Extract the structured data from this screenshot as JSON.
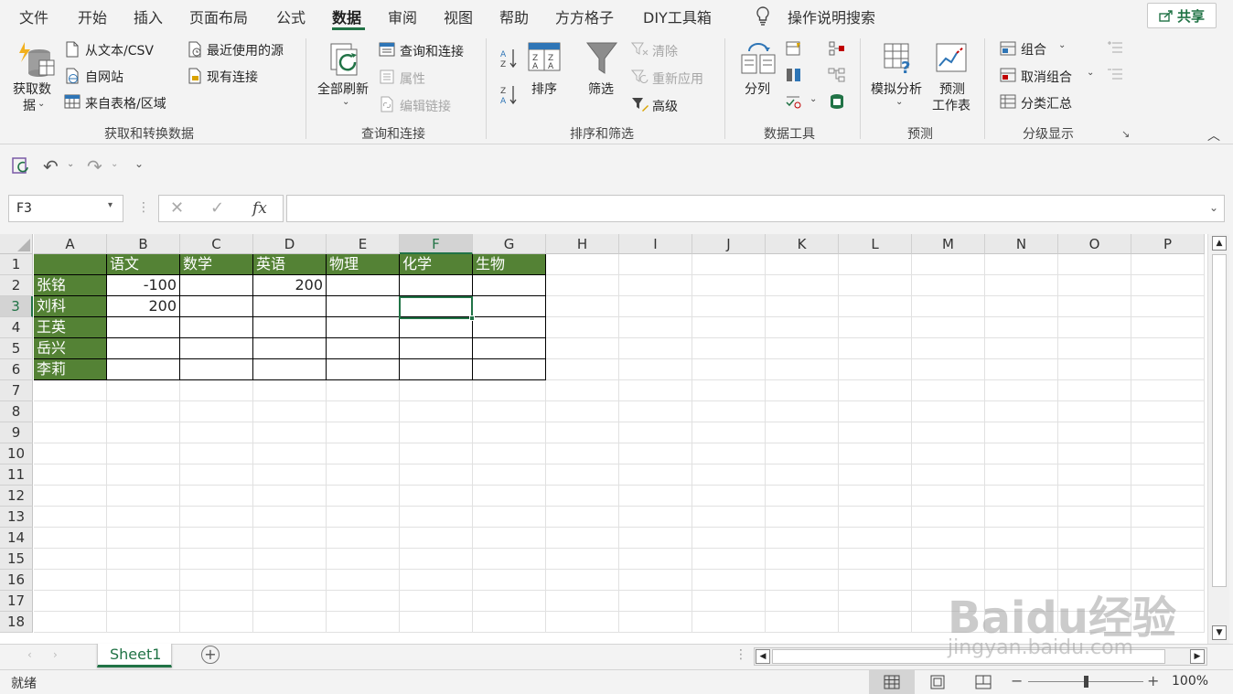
{
  "menu": {
    "tabs": [
      "文件",
      "开始",
      "插入",
      "页面布局",
      "公式",
      "数据",
      "审阅",
      "视图",
      "帮助",
      "方方格子",
      "DIY工具箱"
    ],
    "active": "数据",
    "search_label": "操作说明搜索",
    "share_label": "共享"
  },
  "ribbon": {
    "get_data": {
      "big_label_1": "获取数",
      "big_label_2": "据",
      "from_text": "从文本/CSV",
      "from_web": "自网站",
      "from_table": "来自表格/区域",
      "recent_sources": "最近使用的源",
      "existing_conn": "现有连接",
      "group": "获取和转换数据"
    },
    "queries": {
      "refresh_all": "全部刷新",
      "queries_conn": "查询和连接",
      "properties": "属性",
      "edit_links": "编辑链接",
      "group": "查询和连接"
    },
    "sort_filter": {
      "sort": "排序",
      "filter": "筛选",
      "clear": "清除",
      "reapply": "重新应用",
      "advanced": "高级",
      "group": "排序和筛选"
    },
    "data_tools": {
      "text_to_columns": "分列",
      "group": "数据工具"
    },
    "forecast": {
      "what_if": "模拟分析",
      "forecast_sheet_1": "预测",
      "forecast_sheet_2": "工作表",
      "group": "预测"
    },
    "outline": {
      "group_btn": "组合",
      "ungroup": "取消组合",
      "subtotal": "分类汇总",
      "group": "分级显示"
    }
  },
  "formula_bar": {
    "name_box": "F3",
    "fx": "fx",
    "formula": ""
  },
  "sheet": {
    "columns": [
      "A",
      "B",
      "C",
      "D",
      "E",
      "F",
      "G",
      "H",
      "I",
      "J",
      "K",
      "L",
      "M",
      "N",
      "O",
      "P"
    ],
    "rows": [
      "1",
      "2",
      "3",
      "4",
      "5",
      "6",
      "7",
      "8",
      "9",
      "10",
      "11",
      "12",
      "13",
      "14",
      "15",
      "16",
      "17",
      "18"
    ],
    "selected_cell": "F3",
    "headers": [
      "",
      "语文",
      "数学",
      "英语",
      "物理",
      "化学",
      "生物"
    ],
    "names": [
      "张铭",
      "刘科",
      "王英",
      "岳兴",
      "李莉"
    ],
    "values": [
      [
        "-100",
        "",
        "200",
        "",
        "",
        ""
      ],
      [
        "200",
        "",
        "",
        "",
        "",
        ""
      ],
      [
        "",
        "",
        "",
        "",
        "",
        ""
      ],
      [
        "",
        "",
        "",
        "",
        "",
        ""
      ],
      [
        "",
        "",
        "",
        "",
        "",
        ""
      ]
    ],
    "table_header_color": "#548235"
  },
  "tabs": {
    "sheet_name": "Sheet1"
  },
  "status": {
    "ready": "就绪",
    "zoom": "100%",
    "zoom_fraction": 0.5
  },
  "watermark": {
    "brand": "Baidu经验",
    "url": "jingyan.baidu.com"
  }
}
